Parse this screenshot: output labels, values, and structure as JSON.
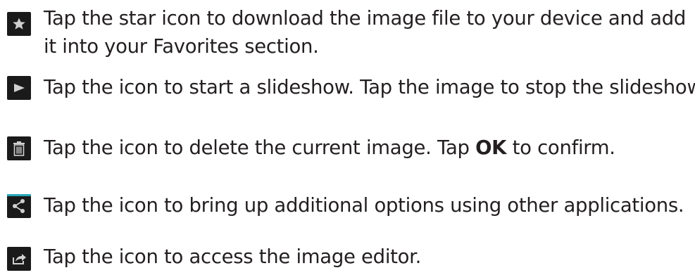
{
  "instructions": [
    {
      "icon": "star-icon",
      "lines": [
        "Tap the star icon to download the image file to your device and add",
        "it into your Favorites section."
      ]
    },
    {
      "icon": "play-icon",
      "text": "Tap the icon to start a slideshow. Tap the image to stop the slideshow."
    },
    {
      "icon": "trash-icon",
      "text_before": "Tap the icon to delete the current image. Tap ",
      "bold": "OK",
      "text_after": " to confirm."
    },
    {
      "icon": "share-icon",
      "text": "Tap the icon to bring up additional options using other applications."
    },
    {
      "icon": "edit-icon",
      "text": "Tap the icon to access the image editor."
    }
  ],
  "colors": {
    "text": "#231f20",
    "icon_bg": "#1a1a1a",
    "icon_fg": "#cfcfcf",
    "share_accent": "#2aa6b8"
  }
}
